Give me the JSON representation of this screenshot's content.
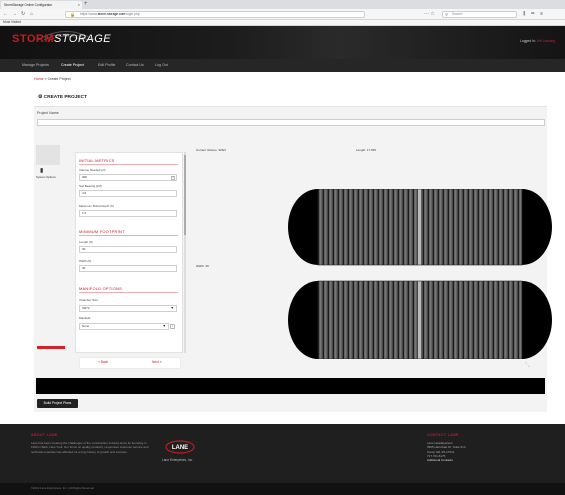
{
  "browser": {
    "tab_title": "StormStorage Online Configurator",
    "url_prefix": "https://www.",
    "url_domain": "storm-storage.com",
    "url_path": "/login.php",
    "search_placeholder": "Search",
    "bookmark": "Most Visited"
  },
  "site": {
    "logo_storm": "STORM",
    "logo_storage": "STORAGE",
    "logged_in_prefix": "Logged In:",
    "logged_in_user": "Jeff Lawning",
    "nav": [
      "Manage Projects",
      "Create Project",
      "Edit Profile",
      "Contact Us",
      "Log Out"
    ]
  },
  "breadcrumb": {
    "home": "Home",
    "separator": "»",
    "current": "Create Project"
  },
  "panel": {
    "title": "CREATE PROJECT",
    "project_name_label": "Project Name",
    "system_options_label": "System Options"
  },
  "form": {
    "initial_metrics": {
      "heading": "INITIAL METRICS",
      "volume_label": "Volume Needed (cf)",
      "volume_value": "300",
      "soil_label": "Soil Bearing (ksf)",
      "soil_value": "4.5",
      "burial_label": "Maximum Burial Depth (ft)",
      "burial_value": "1.5"
    },
    "minimum_footprint": {
      "heading": "MINIMUM FOOTPRINT",
      "length_label": "Length (ft)",
      "length_value": "30",
      "width_label": "Width (ft)",
      "width_value": "30"
    },
    "manifold_options": {
      "heading": "MANIFOLD OPTIONS",
      "chamber_label": "Chamber Size",
      "chamber_value": "SR72",
      "manifold_label": "Manifold",
      "manifold_value": "None"
    },
    "back_label": "« Back",
    "next_label": "Next »"
  },
  "visual": {
    "volume": "Current Volume: 306cf",
    "length": "Length: 17.935",
    "width": "Width: 4ft"
  },
  "build_button": "Build Project Plans",
  "footer": {
    "about_heading": "ABOUT LANE",
    "about_text": "Lane has been meeting the challenges of the construction industry since its founding in 1926 in Bath, New York. Our focus on quality products, responsive customer service and technical expertise has afforded us a long history of growth and success.",
    "logo_text": "LANE",
    "company_name": "Lane Enterprises, Inc.",
    "contact_heading": "CONTACT LANE",
    "contact_lines": [
      "Lane Headquarters",
      "3905 Hartzdale Dr, Suite 514",
      "Camp Hill, PA 17011",
      "717.761.8175"
    ],
    "contact_link": "Additional Contacts",
    "copyright": "©2019 Lane Enterprises, Inc. | All Rights Reserved"
  },
  "colors": {
    "accent": "#c71a22",
    "header_bg": "#1a1a1a",
    "panel_bg": "#f3f3f3"
  }
}
